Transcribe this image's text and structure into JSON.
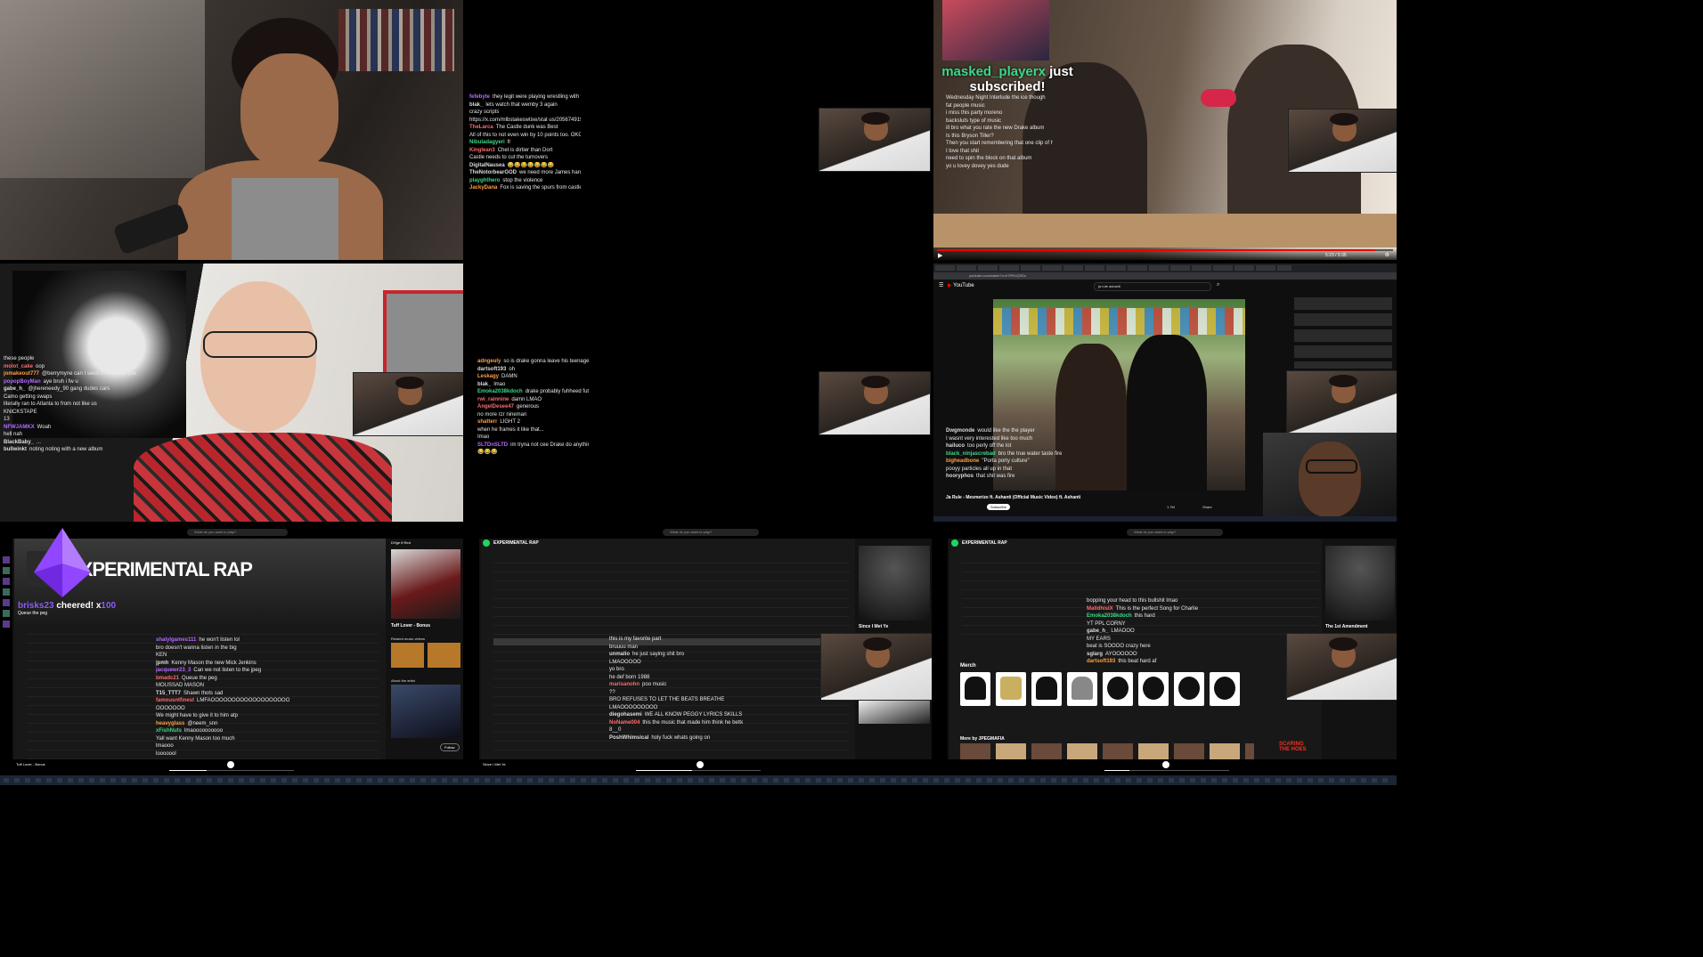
{
  "tiles": {
    "tl": {
      "desc_colors": {
        "bg": "#3a3531"
      }
    },
    "tm": {
      "chat": [
        {
          "user": "fefebyte",
          "color": "#b36bff",
          "msg": "they legit were playing wrestling with wemby last game"
        },
        {
          "user": "blak_",
          "color": "#ddd",
          "msg": "lets watch that wemby 3 again"
        },
        {
          "user": "",
          "color": "#ddd",
          "msg": "crazy scripts"
        },
        {
          "user": "",
          "color": "#ddd",
          "msg": "https://x.com/mlbstakeswtixe/stat us/2056749195213127937?s=46"
        },
        {
          "user": "TheLarca",
          "color": "#ff6b6b",
          "msg": "The Castle dunk was Best"
        },
        {
          "user": "",
          "color": "#ddd",
          "msg": "All of this to not even win by 10 points too. OKC ARE WASHED"
        },
        {
          "user": "Nibuladagyeri",
          "color": "#3bd88a",
          "msg": "fr"
        },
        {
          "user": "Kinglean3",
          "color": "#ff6b6b",
          "msg": "Chet is dirtier than Dort"
        },
        {
          "user": "",
          "color": "#ddd",
          "msg": "Castle needs to cut the turnovers"
        },
        {
          "user": "DigitalNausea",
          "color": "#ddd",
          "msg": "😂😂😂😂😂😂😂"
        },
        {
          "user": "TheNotorbearGOD",
          "color": "#ddd",
          "msg": "we need more James hardens"
        },
        {
          "user": "playghthero",
          "color": "#3bd88a",
          "msg": "stop the violence"
        },
        {
          "user": "JackyDana",
          "color": "#ff9f43",
          "msg": "Fox is saving the spurs from castle next game"
        }
      ]
    },
    "tr": {
      "sub_name": "masked_playerx",
      "sub_text_1": "just",
      "sub_text_2": "subscribed!",
      "chat": [
        {
          "user": "",
          "color": "#ff6b6b",
          "msg": "Wednesday Night Interlude the ice though"
        },
        {
          "user": "",
          "color": "#ddd",
          "msg": "fat people music"
        },
        {
          "user": "",
          "color": "#ddd",
          "msg": "i miss this party moreno"
        },
        {
          "user": "",
          "color": "#ddd",
          "msg": "backsluts type of music"
        },
        {
          "user": "",
          "color": "#ddd",
          "msg": "ill bro what you rate the new Drake album"
        },
        {
          "user": "",
          "color": "#ddd",
          "msg": "Is this Bryson Tiller?"
        },
        {
          "user": "",
          "color": "#ddd",
          "msg": "Then you start remembering that one clip of him Lol"
        },
        {
          "user": "",
          "color": "#ddd",
          "msg": "I love that shit"
        },
        {
          "user": "",
          "color": "#ddd",
          "msg": "need to spin the block on that album"
        },
        {
          "user": "",
          "color": "#ddd",
          "msg": "yo u lovey dovey yes dude"
        }
      ],
      "time": "5:23 / 5:35"
    },
    "ml": {
      "chat": [
        {
          "user": "",
          "color": "#ddd",
          "msg": "these people"
        },
        {
          "user": "molot_cake",
          "color": "#ff6b6b",
          "msg": "oop"
        },
        {
          "user": "jomakeout777",
          "color": "#ff9f43",
          "msg": "@berrymyne can I seed this man to you from my bb?"
        },
        {
          "user": "popopBoyMan",
          "color": "#b36bff",
          "msg": "aye bruh i fw u"
        },
        {
          "user": "gabe_h_",
          "color": "#ddd",
          "msg": "@jhereneedy_90 gang dudes cars"
        },
        {
          "user": "",
          "color": "#3bd88a",
          "msg": "Camo getting swaps"
        },
        {
          "user": "",
          "color": "#ddd",
          "msg": "literally ran to Atlanta to from not like us"
        },
        {
          "user": "",
          "color": "#ddd",
          "msg": "KNICKSTAPE"
        },
        {
          "user": "",
          "color": "#ddd",
          "msg": "13"
        },
        {
          "user": "NFWJAMKX",
          "color": "#b36bff",
          "msg": "Woah"
        },
        {
          "user": "",
          "color": "#ddd",
          "msg": "hell nah"
        },
        {
          "user": "BlackBaby_",
          "color": "#ddd",
          "msg": "..."
        },
        {
          "user": "bullwinkt",
          "color": "#ddd",
          "msg": "noting noting with a new album"
        }
      ]
    },
    "mm": {
      "chat": [
        {
          "user": "adngeuly",
          "color": "#ff9f43",
          "msg": "so is drake gonna leave his teenage angst mental state by age 50? I just can't believe the way he acts while 40."
        },
        {
          "user": "dartsoft193",
          "color": "#ddd",
          "msg": "oh"
        },
        {
          "user": "Leskagy",
          "color": "#ff9f43",
          "msg": "DAMN"
        },
        {
          "user": "blak_",
          "color": "#ddd",
          "msg": "lmao"
        },
        {
          "user": "Emoka2038kdoch",
          "color": "#3bd88a",
          "msg": "drake probably fuhheed futures fuuzz"
        },
        {
          "user": "rwi_rainnine",
          "color": "#ff6b6b",
          "msg": "damn LMAO"
        },
        {
          "user": "AngelDesee47",
          "color": "#ff6b6b",
          "msg": "generous"
        },
        {
          "user": "",
          "color": "#3bd88a",
          "msg": "no more rzr nineman"
        },
        {
          "user": "shatterr",
          "color": "#ff9f43",
          "msg": "LIGHT 2"
        },
        {
          "user": "",
          "color": "#ddd",
          "msg": "when he frames it like that..."
        },
        {
          "user": "",
          "color": "#ddd",
          "msg": "Imao"
        },
        {
          "user": "SLTDnSLTD",
          "color": "#b36bff",
          "msg": "im tryna not cee Drake do anything"
        },
        {
          "user": "",
          "color": "#ddd",
          "msg": "😂😂😂"
        }
      ]
    },
    "mr": {
      "url": "youtube.com/watch?v=h7PIKrQSDc",
      "search": "ja rule ashanti",
      "video_title": "Ja Rule - Mesmerize ft. Ashanti (Official Music Video) ft. Ashanti",
      "subscribe": "Subscribe",
      "likes": "1.7M",
      "share": "Share",
      "chat": [
        {
          "user": "Dwgmonde",
          "color": "#ddd",
          "msg": "would like the the player"
        },
        {
          "user": "",
          "color": "#ddd",
          "msg": "I wasnt very interested like too much"
        },
        {
          "user": "hailuco",
          "color": "#ddd",
          "msg": "too perly off the lot"
        },
        {
          "user": "black_ninjascrebad",
          "color": "#3bd88a",
          "msg": "bro the true water taste fire"
        },
        {
          "user": "bigheadbone",
          "color": "#ff9f43",
          "msg": "\"Porta porty culture\""
        },
        {
          "user": "",
          "color": "#ddd",
          "msg": "pooyy particles all up in that"
        },
        {
          "user": "hooryphos",
          "color": "#ddd",
          "msg": "that shit was fire"
        }
      ]
    },
    "bl": {
      "search_placeholder": "What do you want to play?",
      "playlist_title": "EXPERIMENTAL RAP",
      "cheer_user": "brisks23",
      "cheer_text": "cheered! x",
      "cheer_amount": "100",
      "queue_text": "Queue the peg",
      "right_title": "Tuff Lover - Bonus",
      "right_header": "Di'Ige ft Red",
      "related": "Related music videos",
      "about": "About the artist",
      "follow": "Follow",
      "chat": [
        {
          "user": "shalylgames111",
          "color": "#b36bff",
          "msg": "he won't listen lol"
        },
        {
          "user": "",
          "color": "#ddd",
          "msg": "bro doesn't wanna listen in the big"
        },
        {
          "user": "",
          "color": "#ddd",
          "msg": "KEN"
        },
        {
          "user": "jpmh",
          "color": "#ddd",
          "msg": "Kenny Mason the new Mick Jenkins"
        },
        {
          "user": "jacquewr23_3",
          "color": "#b36bff",
          "msg": "Can we not listen to the jpeg"
        },
        {
          "user": "bmadc21",
          "color": "#ff6b6b",
          "msg": "Queue the peg"
        },
        {
          "user": "",
          "color": "#ddd",
          "msg": "MOUSSAD MASON"
        },
        {
          "user": "T15_TTT7",
          "color": "#ddd",
          "msg": "Shawn thots sad"
        },
        {
          "user": "famousntfinest",
          "color": "#ff6b6b",
          "msg": "LMFAOOOOOOOOOOOOOOOOOOOOO"
        },
        {
          "user": "",
          "color": "#ddd",
          "msg": "OOOOOOO"
        },
        {
          "user": "",
          "color": "#ddd",
          "msg": "We might have to give it to him atp"
        },
        {
          "user": "heavyglass",
          "color": "#ff9f43",
          "msg": "@neem_snn"
        },
        {
          "user": "xFishNuts",
          "color": "#3bd88a",
          "msg": "lmaoooooooooo"
        },
        {
          "user": "",
          "color": "#ddd",
          "msg": "Yall want Kenny Mason too much"
        },
        {
          "user": "",
          "color": "#ddd",
          "msg": "lmaooo"
        },
        {
          "user": "",
          "color": "#ddd",
          "msg": "looooool"
        }
      ],
      "now_playing": "Tuff Lover - Bonus"
    },
    "bm": {
      "search_placeholder": "What do you want to play?",
      "playlist_title": "EXPERIMENTAL RAP",
      "right_title": "Since I Met Ye",
      "chat": [
        {
          "user": "",
          "color": "#ddd",
          "msg": "this is my favorite part"
        },
        {
          "user": "",
          "color": "#ff6b6b",
          "msg": "bruuuu man"
        },
        {
          "user": "unmalio",
          "color": "#ddd",
          "msg": "he just saying shit bro"
        },
        {
          "user": "",
          "color": "#ddd",
          "msg": "LMAOOOOO"
        },
        {
          "user": "",
          "color": "#ddd",
          "msg": "yo bro"
        },
        {
          "user": "",
          "color": "#ddd",
          "msg": "he def born 1988"
        },
        {
          "user": "marisanohn",
          "color": "#ff6b6b",
          "msg": "poo music"
        },
        {
          "user": "",
          "color": "#ddd",
          "msg": "??"
        },
        {
          "user": "",
          "color": "#ddd",
          "msg": "BRO REFUSES TO LET THE BEATS BREATHE"
        },
        {
          "user": "",
          "color": "#ddd",
          "msg": "LMAOOOOOOOOO"
        },
        {
          "user": "diegohasemi",
          "color": "#ddd",
          "msg": "WE ALL KNOW PEGGY LYRICS SKILLS ARE 2/10 LOL"
        },
        {
          "user": "NoName004",
          "color": "#ff6b6b",
          "msg": "this the music that made him think he better than self?"
        },
        {
          "user": "",
          "color": "#ddd",
          "msg": "8__0"
        },
        {
          "user": "PoshWhimsical",
          "color": "#ddd",
          "msg": "holy fuck whats going on"
        }
      ],
      "now_playing": "Since I Met Ye"
    },
    "br": {
      "search_placeholder": "What do you want to play?",
      "playlist_title": "EXPERIMENTAL RAP",
      "right_title": "The 1st Amendment",
      "merch_label": "Merch",
      "more_by": "More by JPEGMAFIA",
      "scaring": "SCARING THE HOES",
      "chat": [
        {
          "user": "",
          "color": "#ddd",
          "msg": "bopping your head to this bullshit lmao"
        },
        {
          "user": "MalldhisIX",
          "color": "#ff6b6b",
          "msg": "This is the perfect Song for Charlie"
        },
        {
          "user": "Emoka2038kdoch",
          "color": "#3bd88a",
          "msg": "this hard"
        },
        {
          "user": "",
          "color": "#ddd",
          "msg": "YT PPL CORNY"
        },
        {
          "user": "gabe_h_",
          "color": "#ddd",
          "msg": "LMAOOO"
        },
        {
          "user": "",
          "color": "#ddd",
          "msg": "MY EARS"
        },
        {
          "user": "",
          "color": "#ddd",
          "msg": "beat is SOOOO crazy here"
        },
        {
          "user": "sglarg",
          "color": "#ddd",
          "msg": "AYOOOOOO"
        },
        {
          "user": "dartsoft193",
          "color": "#ff9f43",
          "msg": "this beat hard af"
        }
      ]
    }
  }
}
